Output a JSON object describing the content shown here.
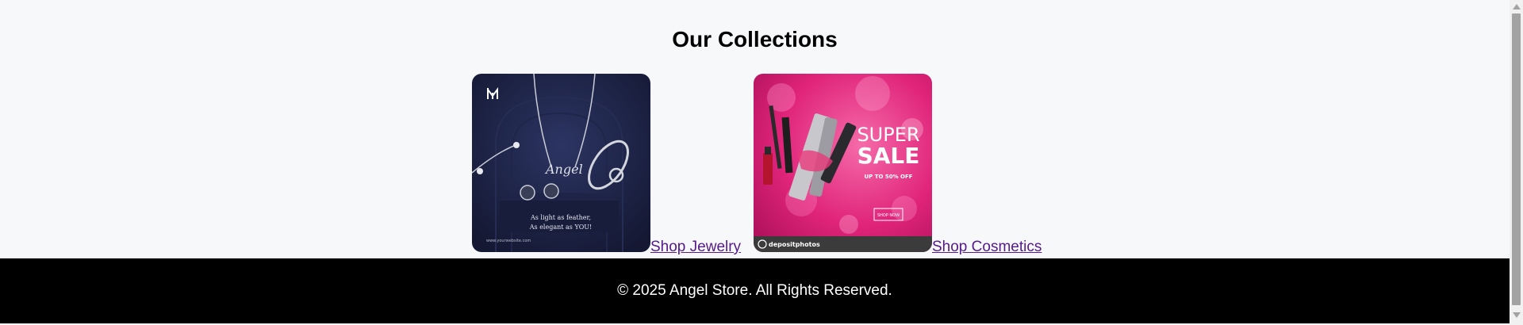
{
  "collections": {
    "title": "Our Collections",
    "items": [
      {
        "image_alt": "Jewelry collection",
        "image_text_line1": "As light as feather,",
        "image_text_line2": "As elegant as YOU!",
        "image_script": "Angel",
        "image_footer": "www.yourwebsite.com",
        "link_label": "Shop Jewelry"
      },
      {
        "image_alt": "Cosmetics collection",
        "image_heading1": "SUPER",
        "image_heading2": "SALE",
        "image_sub": "UP TO 50% OFF",
        "image_button": "SHOP NOW",
        "image_watermark": "depositphotos",
        "link_label": "Shop Cosmetics"
      }
    ]
  },
  "footer": {
    "text": "© 2025 Angel Store. All Rights Reserved."
  },
  "colors": {
    "background": "#f7f8fa",
    "footer_bg": "#000000",
    "link": "#551a8b",
    "jewelry_bg": "#1a1f3d",
    "cosmetics_bg": "#e8287a"
  },
  "icons": {
    "brand_logo": "m-monogram-logo",
    "scroll_up": "arrow-up-icon",
    "scroll_down": "arrow-down-icon"
  }
}
